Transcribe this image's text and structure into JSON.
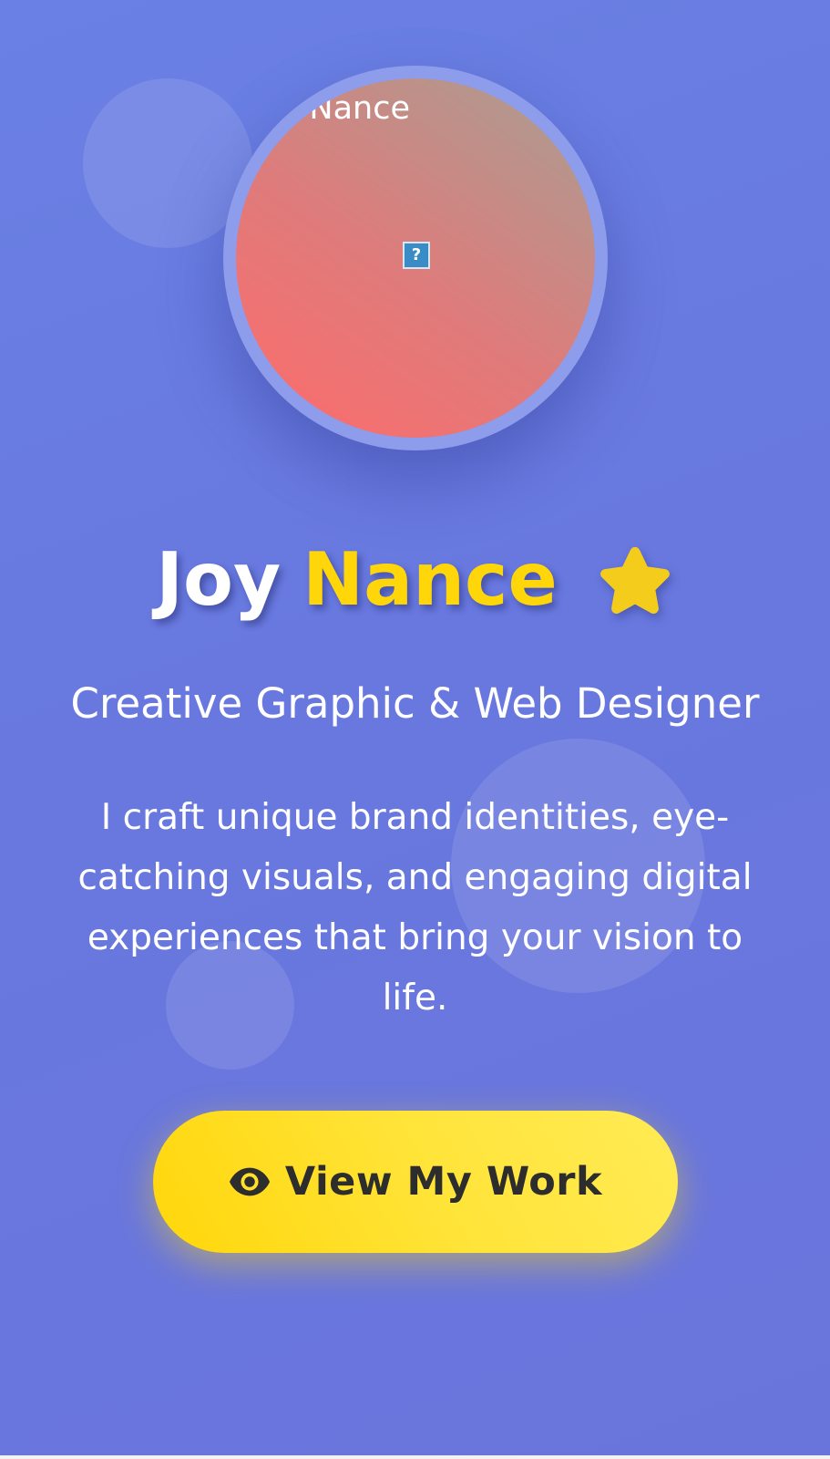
{
  "hero": {
    "avatar_alt": "Joy Nance",
    "avatar_broken_glyph": "?",
    "name_first": "Joy",
    "name_last": "Nance",
    "tagline": "Creative Graphic & Web Designer",
    "bio": "I craft unique brand identities, eye-catching visuals, and engaging digital experiences that bring your vision to life.",
    "cta_label": "View My Work",
    "cta_icon": "eye-icon",
    "name_icon": "star-icon"
  },
  "colors": {
    "background": "#6a7ae0",
    "accent": "#ffd60a",
    "text": "#ffffff",
    "button_text": "#2d2d2d"
  }
}
